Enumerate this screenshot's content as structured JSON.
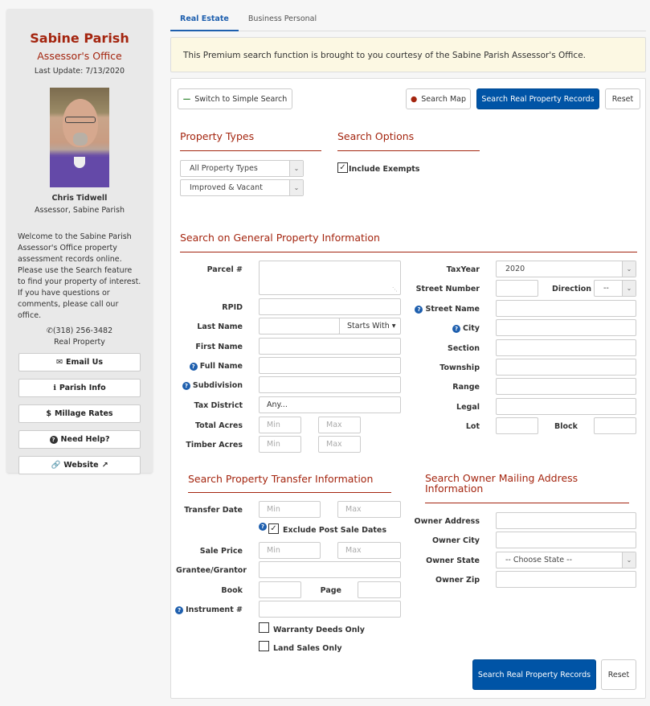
{
  "sidebar": {
    "title": "Sabine Parish",
    "subtitle": "Assessor's Office",
    "last_update": "Last Update: 7/13/2020",
    "photo_alt": "Assessor portrait",
    "name": "Chris Tidwell",
    "role": "Assessor, Sabine Parish",
    "welcome": "Welcome to the Sabine Parish Assessor's Office property assessment records online. Please use the Search feature to find your property of interest. If you have questions or comments, please call our office.",
    "phone": "(318) 256-3482",
    "phone_label": "Real Property",
    "buttons": [
      {
        "label": "Email Us",
        "icon": "envelope-icon"
      },
      {
        "label": "Parish Info",
        "icon": "info-icon"
      },
      {
        "label": "Millage Rates",
        "icon": "dollar-icon"
      },
      {
        "label": "Need Help?",
        "icon": "question-circle-icon"
      },
      {
        "label": "Website",
        "icon": "link-icon",
        "trailing_icon": "external-link-icon"
      }
    ]
  },
  "tabs": [
    {
      "label": "Real Estate",
      "active": true
    },
    {
      "label": "Business Personal",
      "active": false
    }
  ],
  "notice": "This Premium search function is brought to you courtesy of the Sabine Parish Assessor's Office.",
  "toolbar": {
    "simple_search": "Switch to Simple Search",
    "search_map": "Search Map",
    "search": "Search Real Property Records",
    "reset": "Reset"
  },
  "property_types": {
    "heading": "Property Types",
    "select1": "All Property Types",
    "select2": "Improved & Vacant"
  },
  "search_options": {
    "heading": "Search Options",
    "include_exempts": "Include Exempts",
    "include_exempts_checked": true
  },
  "general": {
    "heading": "Search on General Property Information",
    "left": {
      "parcel": "Parcel #",
      "rpid": "RPID",
      "last_name": "Last Name",
      "last_name_mode": "Starts With",
      "first_name": "First Name",
      "full_name": "Full Name",
      "subdivision": "Subdivision",
      "tax_district": "Tax District",
      "tax_district_value": "Any...",
      "total_acres": "Total Acres",
      "timber_acres": "Timber Acres",
      "min_ph": "Min",
      "max_ph": "Max"
    },
    "right": {
      "tax_year": "TaxYear",
      "tax_year_value": "2020",
      "street_number": "Street Number",
      "direction": "Direction",
      "direction_value": "--",
      "street_name": "Street Name",
      "city": "City",
      "section": "Section",
      "township": "Township",
      "range": "Range",
      "legal": "Legal",
      "lot": "Lot",
      "block": "Block"
    }
  },
  "transfer": {
    "heading": "Search Property Transfer Information",
    "transfer_date": "Transfer Date",
    "exclude_post": "Exclude Post Sale Dates",
    "exclude_post_checked": true,
    "sale_price": "Sale Price",
    "grantee": "Grantee/Grantor",
    "book": "Book",
    "page": "Page",
    "instrument": "Instrument #",
    "warranty": "Warranty Deeds Only",
    "warranty_checked": false,
    "land_sales": "Land Sales Only",
    "land_sales_checked": false,
    "min_ph": "Min",
    "max_ph": "Max"
  },
  "owner": {
    "heading": "Search Owner Mailing Address Information",
    "address": "Owner Address",
    "city": "Owner City",
    "state": "Owner State",
    "state_value": "-- Choose State --",
    "zip": "Owner Zip"
  },
  "footer": {
    "search": "Search Real Property Records",
    "reset": "Reset"
  },
  "colors": {
    "accent_red": "#a4250f",
    "primary_blue": "#0054a6",
    "tab_blue": "#1e5fae",
    "notice_bg": "#fcf8e3"
  }
}
